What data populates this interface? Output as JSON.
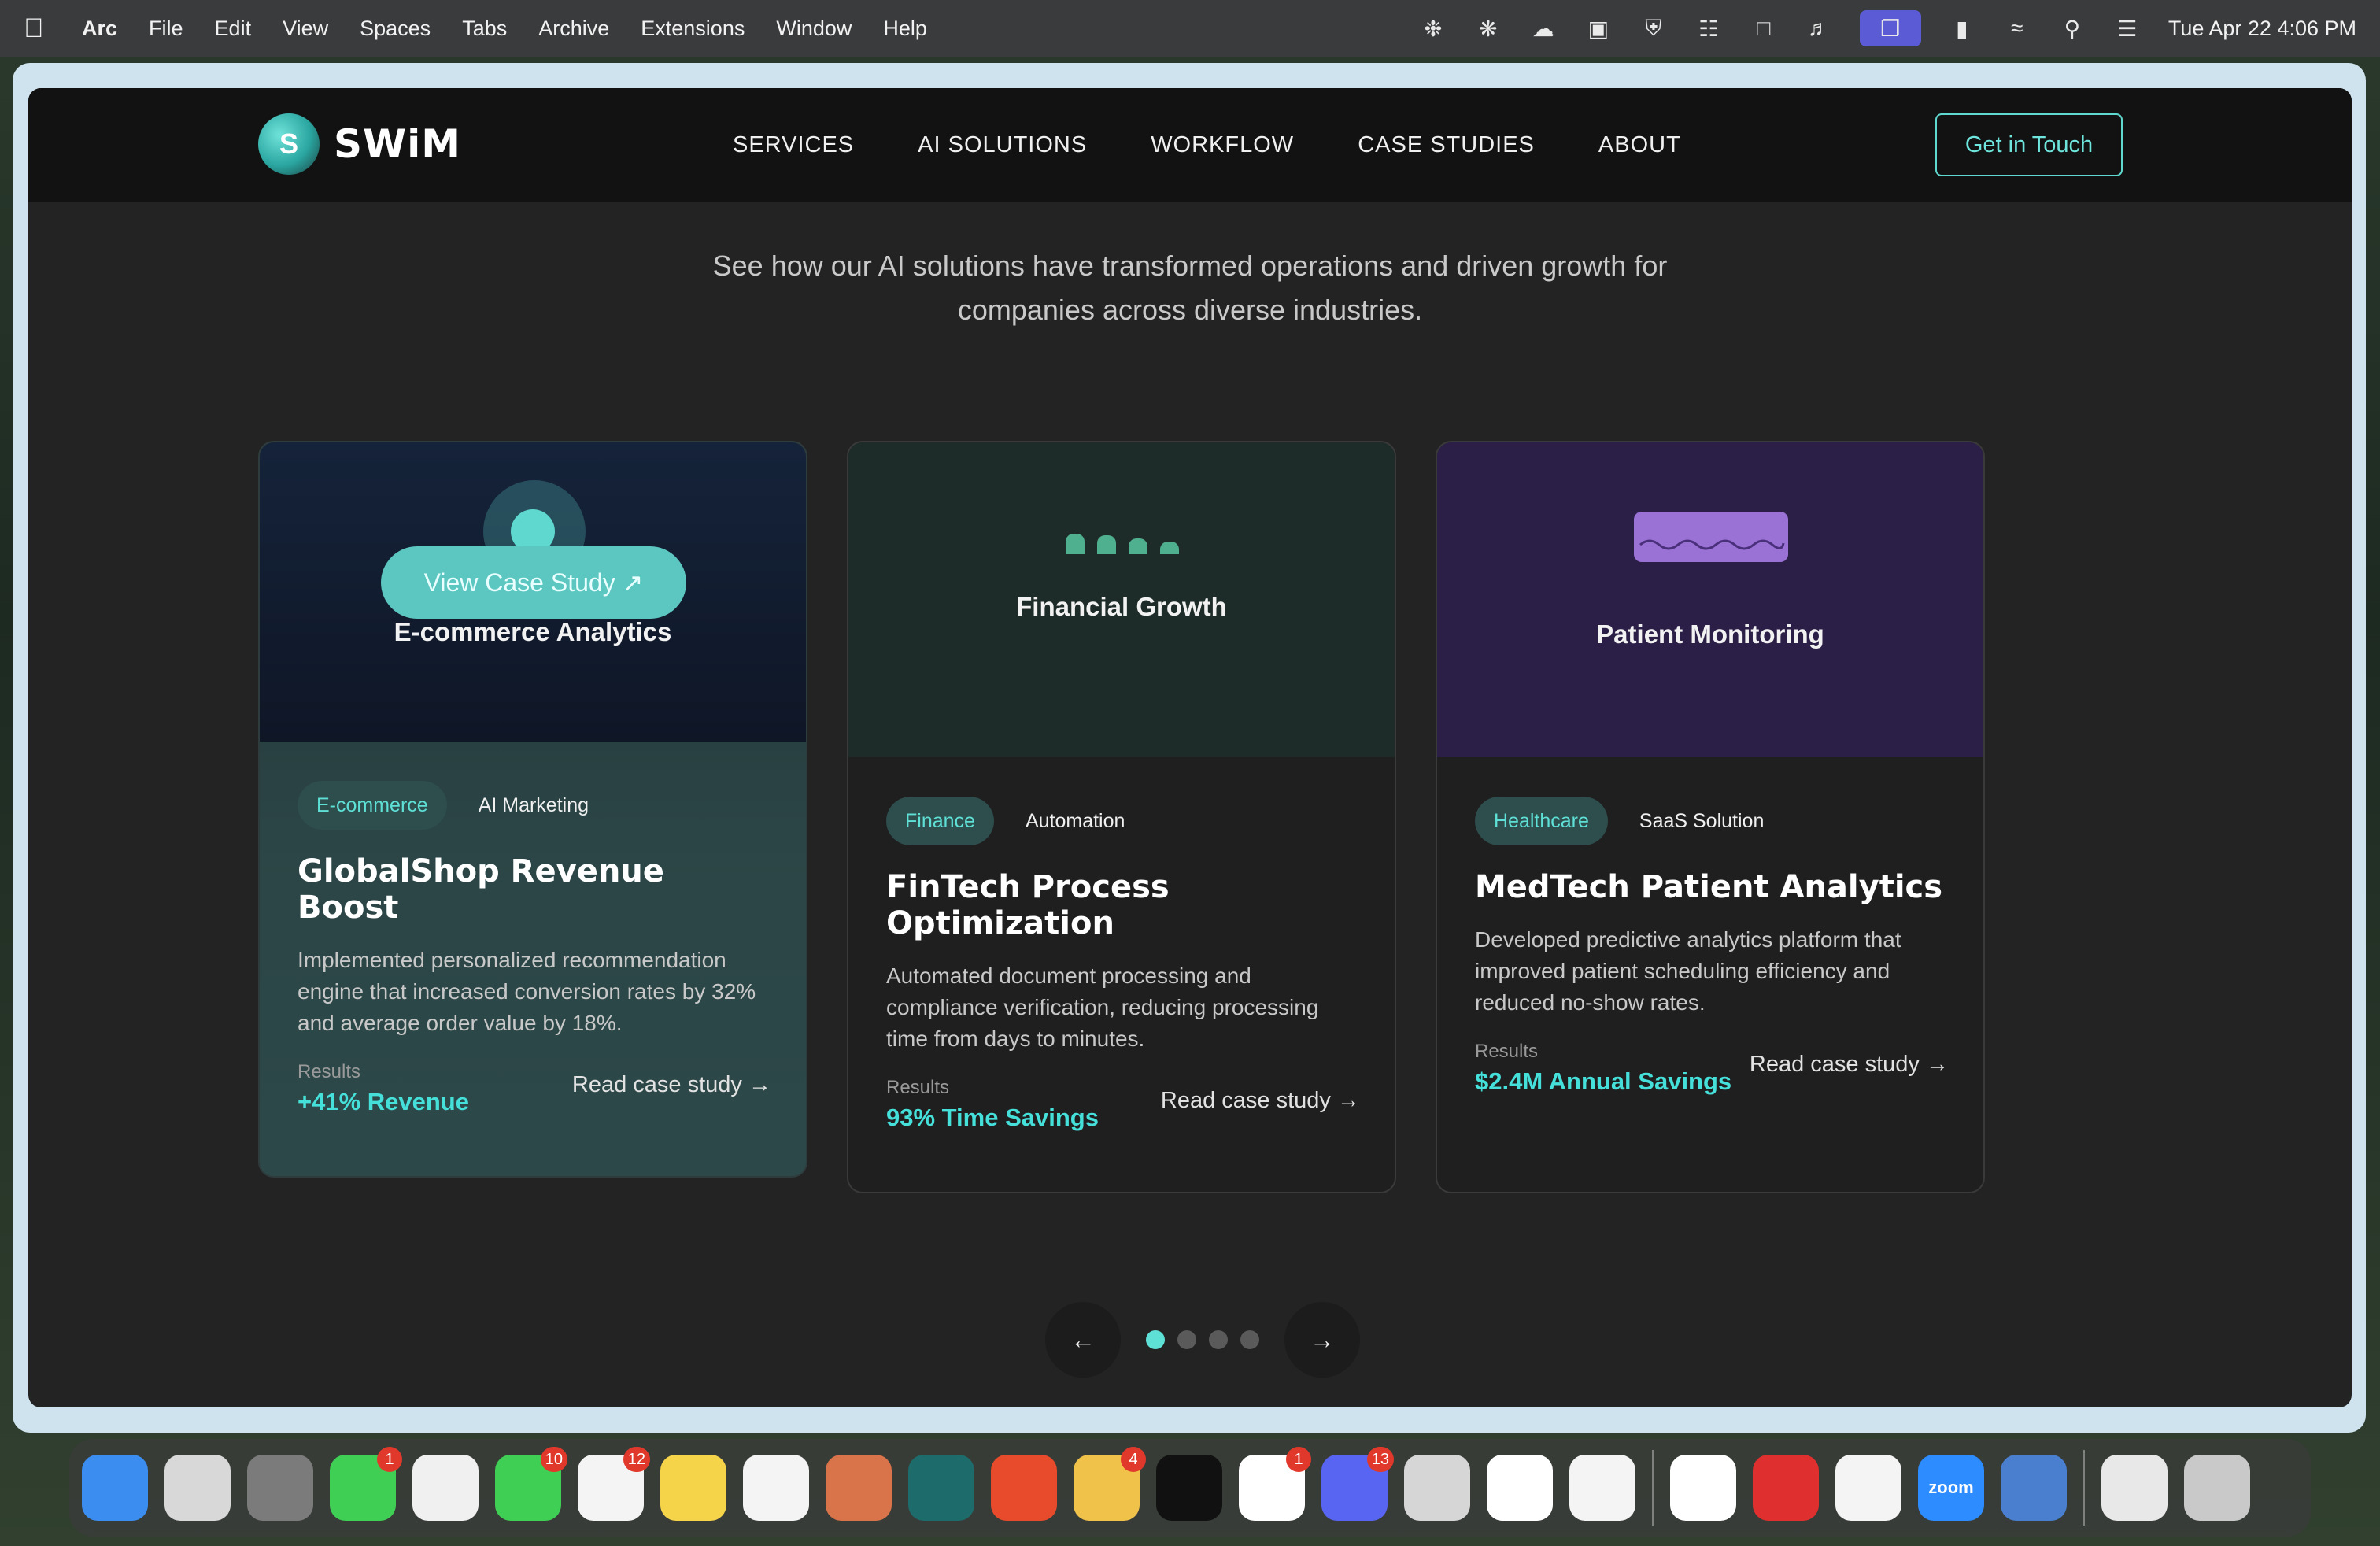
{
  "menubar": {
    "app_name": "Arc",
    "items": [
      "File",
      "Edit",
      "View",
      "Spaces",
      "Tabs",
      "Archive",
      "Extensions",
      "Window",
      "Help"
    ],
    "clock": "Tue Apr 22  4:06 PM"
  },
  "site": {
    "logo_letter": "S",
    "logo_text": "SWiM",
    "nav": [
      "SERVICES",
      "AI SOLUTIONS",
      "WORKFLOW",
      "CASE STUDIES",
      "ABOUT"
    ],
    "cta": "Get in Touch",
    "intro_line1": "See how our AI solutions have transformed operations and driven growth for",
    "intro_line2": "companies across diverse industries."
  },
  "cards": [
    {
      "visual_title": "E-commerce Analytics",
      "view_button": "View Case Study ↗",
      "tag_primary": "E-commerce",
      "tag_secondary": "AI Marketing",
      "title": "GlobalShop Revenue Boost",
      "description": "Implemented personalized recommendation engine that increased conversion rates by 32% and average order value by 18%.",
      "results_label": "Results",
      "results_value": "+41% Revenue",
      "link": "Read case study →"
    },
    {
      "visual_title": "Financial Growth",
      "tag_primary": "Finance",
      "tag_secondary": "Automation",
      "title": "FinTech Process Optimization",
      "description": "Automated document processing and compliance verification, reducing processing time from days to minutes.",
      "results_label": "Results",
      "results_value": "93% Time Savings",
      "link": "Read case study →"
    },
    {
      "visual_title": "Patient Monitoring",
      "tag_primary": "Healthcare",
      "tag_secondary": "SaaS Solution",
      "title": "MedTech Patient Analytics",
      "description": "Developed predictive analytics platform that improved patient scheduling efficiency and reduced no-show rates.",
      "results_label": "Results",
      "results_value": "$2.4M Annual Savings",
      "link": "Read case study →"
    }
  ],
  "carousel": {
    "prev": "←",
    "next": "→",
    "pages": 4,
    "active": 1
  },
  "dock": {
    "apps": [
      {
        "name": "finder",
        "color": "#3c8df0",
        "badge": ""
      },
      {
        "name": "launchpad",
        "color": "#d8d8d8",
        "badge": ""
      },
      {
        "name": "settings",
        "color": "#7b7b7b",
        "badge": ""
      },
      {
        "name": "messages",
        "color": "#3fcf55",
        "badge": "1"
      },
      {
        "name": "photos",
        "color": "#f0f0f0",
        "badge": ""
      },
      {
        "name": "facetime",
        "color": "#3fcf55",
        "badge": "10"
      },
      {
        "name": "reminders",
        "color": "#f4f4f4",
        "badge": "12"
      },
      {
        "name": "notes",
        "color": "#f5d44a",
        "badge": ""
      },
      {
        "name": "chatgpt",
        "color": "#f4f4f4",
        "badge": ""
      },
      {
        "name": "claude",
        "color": "#d9734a",
        "badge": ""
      },
      {
        "name": "perplexity",
        "color": "#1d6b6b",
        "badge": ""
      },
      {
        "name": "app-red",
        "color": "#e74b2b",
        "badge": ""
      },
      {
        "name": "mail",
        "color": "#f0c24a",
        "badge": "4"
      },
      {
        "name": "linear",
        "color": "#111111",
        "badge": ""
      },
      {
        "name": "notion",
        "color": "#ffffff",
        "badge": "1"
      },
      {
        "name": "discord",
        "color": "#5865f2",
        "badge": "13"
      },
      {
        "name": "iphone-mirroring",
        "color": "#d6d6d6",
        "badge": ""
      },
      {
        "name": "affinity",
        "color": "#ffffff",
        "badge": ""
      },
      {
        "name": "passwords",
        "color": "#f4f4f4",
        "badge": ""
      },
      {
        "name": "slack",
        "color": "#ffffff",
        "badge": ""
      },
      {
        "name": "vpn",
        "color": "#e02f2f",
        "badge": ""
      },
      {
        "name": "chrome",
        "color": "#f4f4f4",
        "badge": ""
      },
      {
        "name": "zoom",
        "color": "#2d8cff",
        "badge": ""
      },
      {
        "name": "display",
        "color": "#4a7fd0",
        "badge": ""
      },
      {
        "name": "file",
        "color": "#e8e8e8",
        "badge": ""
      },
      {
        "name": "trash",
        "color": "#c9c9c9",
        "badge": ""
      }
    ],
    "zoom_label": "zoom"
  }
}
